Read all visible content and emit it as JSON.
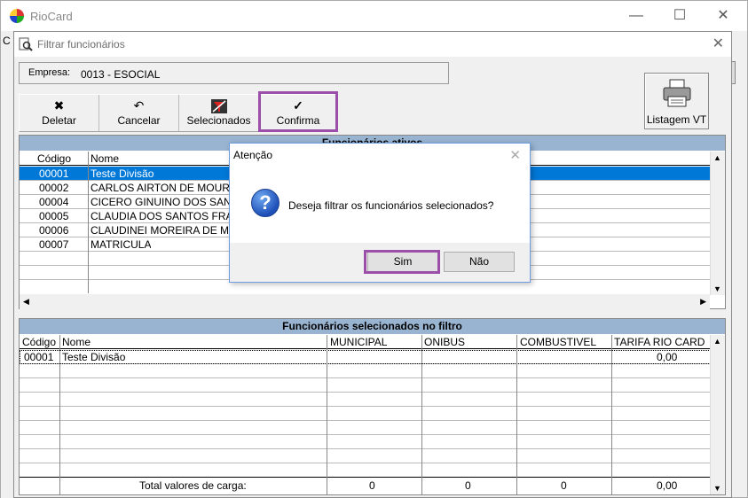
{
  "main_window": {
    "title": "RioCard",
    "left_clip_text": "C"
  },
  "dialog": {
    "title": "Filtrar funcionários",
    "empresa_label": "Empresa:",
    "empresa_value": "0013 - ESOCIAL",
    "toolbar": {
      "deletar": "Deletar",
      "cancelar": "Cancelar",
      "selecionados": "Selecionados",
      "confirma": "Confirma"
    },
    "listagem_vt": "Listagem VT",
    "active_grid": {
      "title": "Funcionários ativos",
      "headers": {
        "codigo": "Código",
        "nome": "Nome"
      },
      "rows": [
        {
          "codigo": "00001",
          "nome": "Teste Divisão"
        },
        {
          "codigo": "00002",
          "nome": "CARLOS AIRTON DE MOURA"
        },
        {
          "codigo": "00004",
          "nome": "CICERO GINUINO DOS SANT"
        },
        {
          "codigo": "00005",
          "nome": "CLAUDIA DOS SANTOS FRA"
        },
        {
          "codigo": "00006",
          "nome": "CLAUDINEI MOREIRA DE MA"
        },
        {
          "codigo": "00007",
          "nome": "MATRICULA"
        }
      ]
    },
    "selected_grid": {
      "title": "Funcionários selecionados no filtro",
      "headers": {
        "codigo": "Código",
        "nome": "Nome",
        "municipal": "MUNICIPAL",
        "onibus": "ONIBUS",
        "combustivel": "COMBUSTIVEL",
        "tarifa": "TARIFA RIO CARD"
      },
      "rows": [
        {
          "codigo": "00001",
          "nome": "Teste Divisão",
          "municipal": "",
          "onibus": "",
          "combustivel": "",
          "tarifa": "0,00"
        }
      ],
      "total": {
        "label": "Total valores de carga:",
        "municipal": "0",
        "onibus": "0",
        "combustivel": "0",
        "tarifa": "0,00"
      }
    }
  },
  "modal": {
    "title": "Atenção",
    "message": "Deseja filtrar os funcionários selecionados?",
    "yes": "Sim",
    "no": "Não"
  },
  "colors": {
    "highlight": "#9b4fa8",
    "selection": "#0078d7",
    "grid_title": "#99b4d1"
  }
}
